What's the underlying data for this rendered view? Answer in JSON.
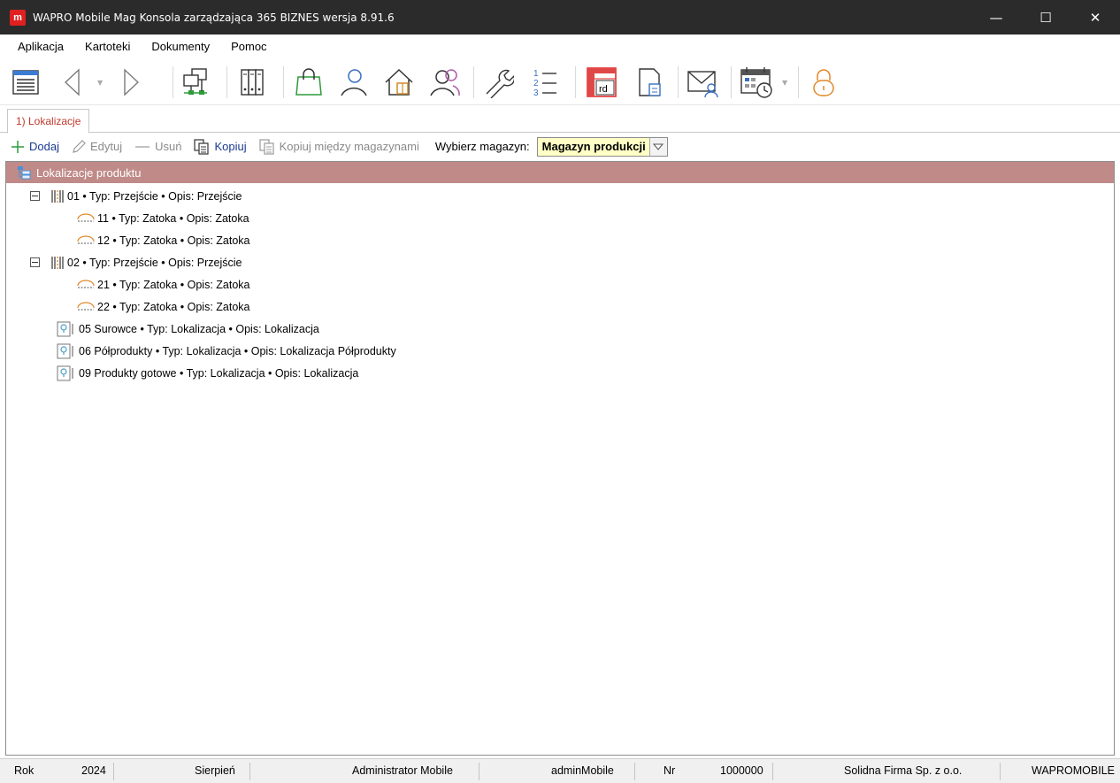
{
  "window": {
    "title": "WAPRO Mobile Mag Konsola zarządzająca 365 BIZNES wersja 8.91.6",
    "logo_letter": "m",
    "minimize": "—",
    "maximize": "☐",
    "close": "✕"
  },
  "menu": [
    "Aplikacja",
    "Kartoteki",
    "Dokumenty",
    "Pomoc"
  ],
  "tabs": [
    {
      "label": "1) Lokalizacje",
      "active": true
    }
  ],
  "actions": {
    "add": "Dodaj",
    "edit": "Edytuj",
    "delete": "Usuń",
    "copy": "Kopiuj",
    "copy_between": "Kopiuj między magazynami",
    "select_label": "Wybierz magazyn:",
    "select_value": "Magazyn produkcji"
  },
  "tree": {
    "header": "Lokalizacje produktu",
    "nodes": [
      {
        "label": "01 • Typ: Przejście • Opis: Przejście",
        "kind": "aisle",
        "level": 0,
        "expanded": true
      },
      {
        "label": "11 • Typ: Zatoka • Opis: Zatoka",
        "kind": "bay",
        "level": 1
      },
      {
        "label": "12 • Typ: Zatoka • Opis: Zatoka",
        "kind": "bay",
        "level": 1
      },
      {
        "label": "02 • Typ: Przejście • Opis: Przejście",
        "kind": "aisle",
        "level": 0,
        "expanded": true
      },
      {
        "label": "21 • Typ: Zatoka • Opis: Zatoka",
        "kind": "bay",
        "level": 1
      },
      {
        "label": "22 • Typ: Zatoka • Opis: Zatoka",
        "kind": "bay",
        "level": 1
      },
      {
        "label": "05 Surowce • Typ: Lokalizacja • Opis: Lokalizacja",
        "kind": "location",
        "level": 0
      },
      {
        "label": "06 Półprodukty • Typ: Lokalizacja • Opis: Lokalizacja Półprodukty",
        "kind": "location",
        "level": 0
      },
      {
        "label": "09 Produkty gotowe • Typ: Lokalizacja • Opis: Lokalizacja",
        "kind": "location",
        "level": 0
      }
    ]
  },
  "toolbar": {
    "report_icon_text": "rd",
    "number_list": [
      "1",
      "2",
      "3"
    ]
  },
  "status": {
    "rok_label": "Rok",
    "rok_value": "2024",
    "month": "Sierpień",
    "user": "Administrator Mobile",
    "login": "adminMobile",
    "nr_label": "Nr",
    "nr_value": "1000000",
    "company": "Solidna Firma Sp. z o.o.",
    "db": "WAPROMOBILE"
  },
  "colors": {
    "titlebar": "#2b2b2b",
    "accent_red": "#e02020",
    "tree_header": "#bf8a88",
    "link_blue": "#1c3b8f",
    "select_bg": "#ffffc6"
  }
}
